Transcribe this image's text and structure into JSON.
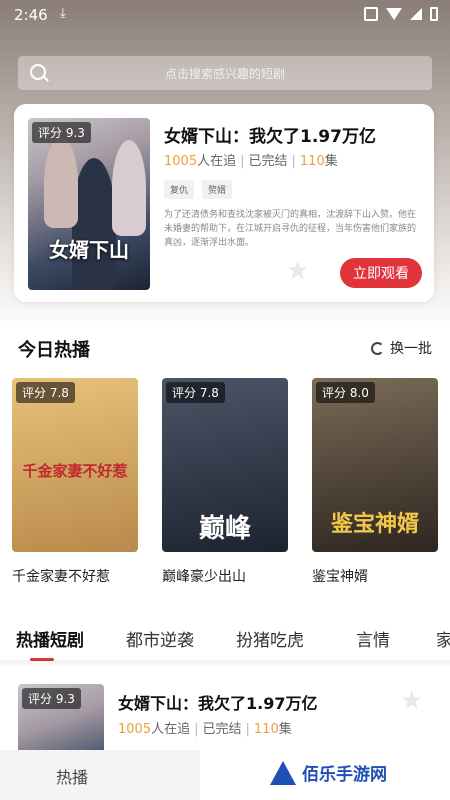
{
  "status_bar": {
    "time": "2:46",
    "download_icon": "download-icon"
  },
  "search": {
    "placeholder": "点击搜索感兴趣的短剧"
  },
  "featured": {
    "rating": "评分 9.3",
    "poster_text": "女婿下山",
    "title": "女婿下山：我欠了1.97万亿",
    "followers": "1005",
    "followers_suffix": "人在追",
    "status": "已完结",
    "episodes": "110",
    "episodes_suffix": "集",
    "tags": [
      "复仇",
      "赘婿"
    ],
    "description": "为了还清债务和查找沈家被灭门的真相，沈渡辞下山入赘。他在未婚妻的帮助下，在江城开启寻仇的征程，当年伤害他们家族的真凶，逐渐浮出水面。",
    "watch_label": "立即观看"
  },
  "today_hot": {
    "title": "今日热播",
    "refresh_label": "换一批",
    "items": [
      {
        "rating": "评分 7.8",
        "poster_text": "千金家妻不好惹",
        "name": "千金家妻不好惹",
        "colors": [
          "#e8c27a",
          "#b98a4b"
        ]
      },
      {
        "rating": "评分 7.8",
        "poster_text": "巅峰",
        "name": "巅峰豪少出山",
        "colors": [
          "#4b5668",
          "#1d2330"
        ]
      },
      {
        "rating": "评分 8.0",
        "poster_text": "鉴宝神婿",
        "name": "鉴宝神婿",
        "colors": [
          "#7b6b58",
          "#2e2620"
        ]
      }
    ]
  },
  "tabs": [
    "热播短剧",
    "都市逆袭",
    "扮猪吃虎",
    "言情",
    "家"
  ],
  "list_item": {
    "rating": "评分 9.3",
    "title": "女婿下山：我欠了1.97万亿",
    "followers": "1005",
    "followers_suffix": "人在追",
    "status": "已完结",
    "episodes": "110",
    "episodes_suffix": "集"
  },
  "bottom_nav": {
    "label": "热播"
  },
  "watermark": {
    "text": "佰乐手游网"
  }
}
